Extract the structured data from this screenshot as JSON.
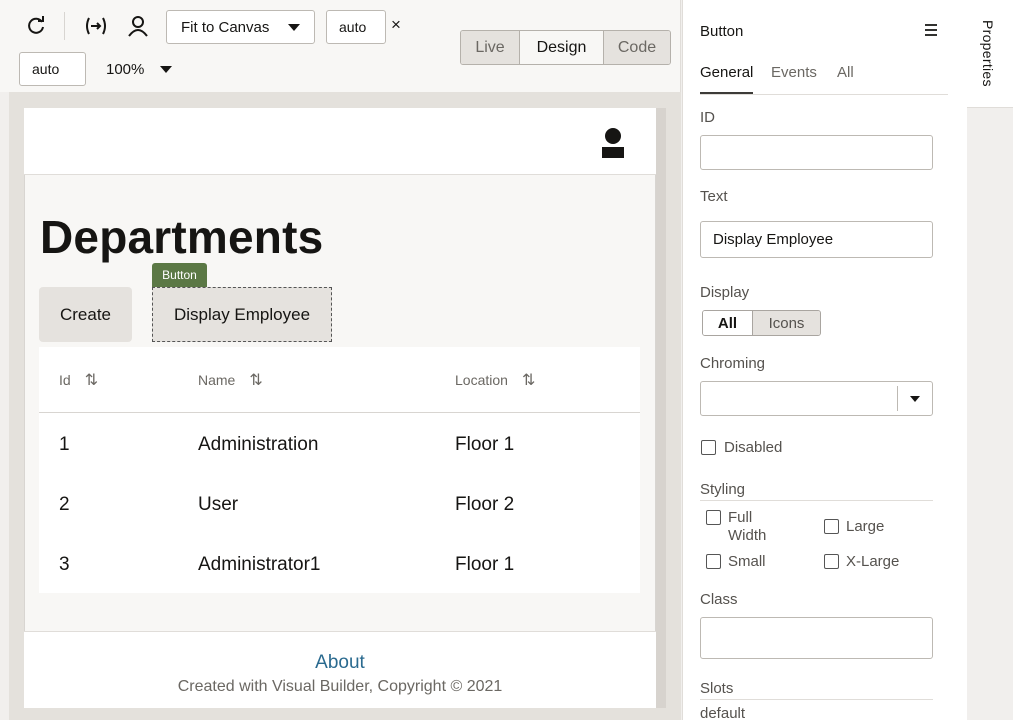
{
  "toolbar": {
    "fit_select": "Fit to Canvas",
    "width_value": "auto",
    "close_glyph": "×",
    "height_value": "auto",
    "zoom": "100%",
    "modes": [
      "Live",
      "Design",
      "Code"
    ],
    "active_mode": "Design"
  },
  "page": {
    "title": "Departments",
    "create_label": "Create",
    "display_label": "Display Employee",
    "selection_tag": "Button",
    "table": {
      "headers": [
        "Id",
        "Name",
        "Location"
      ],
      "rows": [
        [
          "1",
          "Administration",
          "Floor 1"
        ],
        [
          "2",
          "User",
          "Floor 2"
        ],
        [
          "3",
          "Administrator1",
          "Floor 1"
        ]
      ]
    },
    "footer_link": "About",
    "footer_text": "Created with Visual Builder, Copyright © 2021"
  },
  "properties": {
    "component": "Button",
    "tabs": [
      "General",
      "Events",
      "All"
    ],
    "id_label": "ID",
    "id_value": "",
    "text_label": "Text",
    "text_value": "Display Employee",
    "display_label": "Display",
    "display_options": [
      "All",
      "Icons"
    ],
    "chroming_label": "Chroming",
    "chroming_value": "",
    "disabled_label": "Disabled",
    "styling_label": "Styling",
    "styling_options": [
      "Full Width",
      "Large",
      "Small",
      "X-Large"
    ],
    "class_label": "Class",
    "class_value": "",
    "slots_label": "Slots",
    "slot_default": "default"
  },
  "side_tab": "Properties",
  "icons": {
    "refresh": "refresh-icon",
    "brackets": "expand-brackets-icon",
    "user": "user-icon",
    "hamburger": "hamburger-menu-icon",
    "sort": "sort-icon"
  },
  "colors": {
    "selection_tag": "#5b7845",
    "link": "#2a6a8f"
  }
}
